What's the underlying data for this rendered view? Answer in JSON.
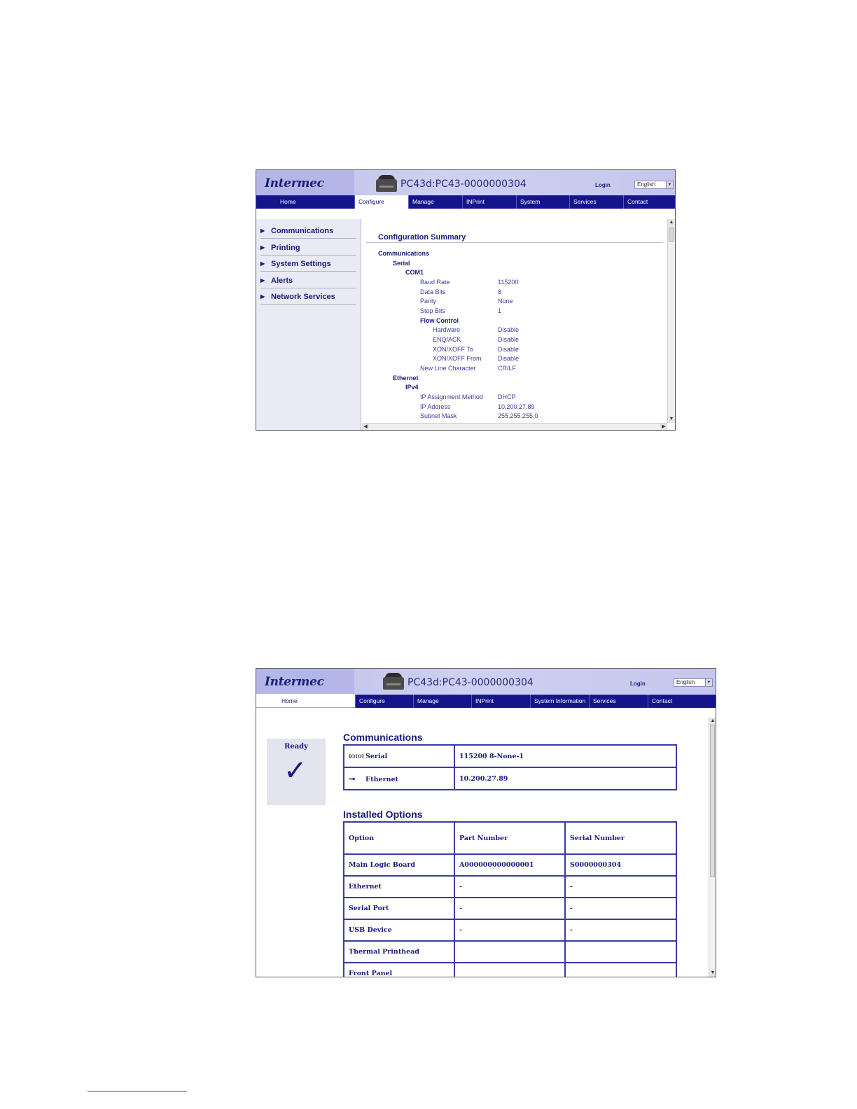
{
  "brand": {
    "logo": "Intermec"
  },
  "device_title": "PC43d:PC43-0000000304",
  "login_label": "Login",
  "language": {
    "selected": "English"
  },
  "nav": [
    "Home",
    "Configure",
    "Manage",
    "INPrint",
    "System Information",
    "Services",
    "Contact"
  ],
  "screen1": {
    "active_tab": "Configure",
    "sidebar": [
      "Communications",
      "Printing",
      "System Settings",
      "Alerts",
      "Network Services"
    ],
    "summary_title": "Configuration Summary",
    "config": [
      {
        "label": "Communications",
        "value": ""
      },
      {
        "label": "Serial",
        "value": ""
      },
      {
        "label": "COM1",
        "value": ""
      },
      {
        "label": "Baud Rate",
        "value": "115200"
      },
      {
        "label": "Data Bits",
        "value": "8"
      },
      {
        "label": "Parity",
        "value": "None"
      },
      {
        "label": "Stop Bits",
        "value": "1"
      },
      {
        "label": "Flow Control",
        "value": ""
      },
      {
        "label": "Hardware",
        "value": "Disable"
      },
      {
        "label": "ENQ/ACK",
        "value": "Disable"
      },
      {
        "label": "XON/XOFF To",
        "value": "Disable"
      },
      {
        "label": "XON/XOFF From",
        "value": "Disable"
      },
      {
        "label": "New Line Character",
        "value": "CR/LF"
      },
      {
        "label": "Ethernet",
        "value": ""
      },
      {
        "label": "IPv4",
        "value": ""
      },
      {
        "label": "IP Assignment Method",
        "value": "DHCP"
      },
      {
        "label": "IP Address",
        "value": "10.200.27.89"
      },
      {
        "label": "Subnet Mask",
        "value": "255.255.255.0"
      }
    ]
  },
  "screen2": {
    "active_tab": "Home",
    "status": "Ready",
    "communications_title": "Communications",
    "communications": [
      {
        "icon_text": "IOIOI",
        "name": "Serial",
        "value": "115200 8-None-1"
      },
      {
        "icon_text": "",
        "name": "Ethernet",
        "value": "10.200.27.89"
      }
    ],
    "options_title": "Installed Options",
    "options_headers": [
      "Option",
      "Part Number",
      "Serial Number"
    ],
    "options_rows": [
      [
        "Main Logic Board",
        "A000000000000001",
        "S0000000304"
      ],
      [
        "Ethernet",
        "-",
        "-"
      ],
      [
        "Serial Port",
        "-",
        "-"
      ],
      [
        "USB Device",
        "-",
        "-"
      ],
      [
        "Thermal Printhead",
        "",
        ""
      ],
      [
        "Front Panel",
        "",
        ""
      ]
    ]
  }
}
